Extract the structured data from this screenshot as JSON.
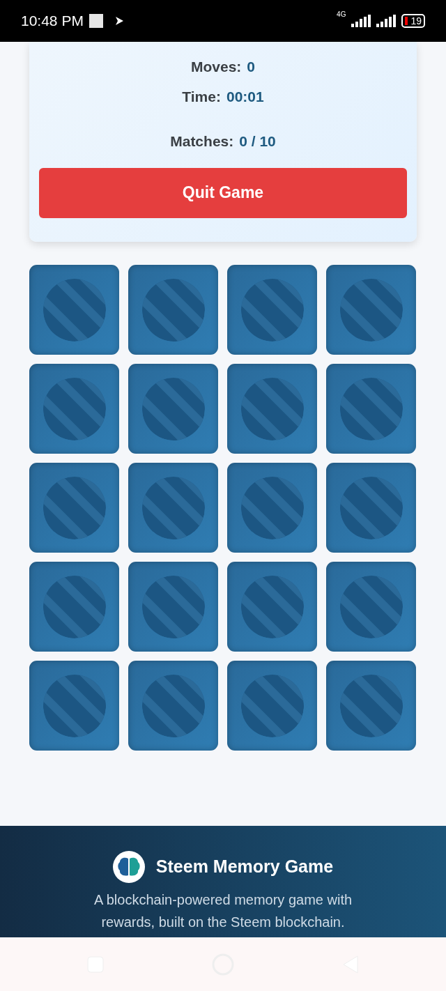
{
  "status_bar": {
    "time": "10:48 PM",
    "network": "4G",
    "battery": "19"
  },
  "stats": [
    {
      "label": "Moves:",
      "value": "0"
    },
    {
      "label": "Time:",
      "value": "00:01"
    },
    {
      "label": "Matches:",
      "value": "0 / 10"
    }
  ],
  "quit_button": "Quit Game",
  "cards": [
    {
      "flipped": false
    },
    {
      "flipped": false
    },
    {
      "flipped": false
    },
    {
      "flipped": false
    },
    {
      "flipped": false
    },
    {
      "flipped": false
    },
    {
      "flipped": false
    },
    {
      "flipped": false
    },
    {
      "flipped": false
    },
    {
      "flipped": false
    },
    {
      "flipped": false
    },
    {
      "flipped": false
    },
    {
      "flipped": false
    },
    {
      "flipped": false
    },
    {
      "flipped": false
    },
    {
      "flipped": false
    },
    {
      "flipped": false
    },
    {
      "flipped": false
    },
    {
      "flipped": false
    },
    {
      "flipped": false
    }
  ],
  "footer": {
    "title": "Steem Memory Game",
    "description": "A blockchain-powered memory game with rewards, built on the Steem blockchain."
  }
}
